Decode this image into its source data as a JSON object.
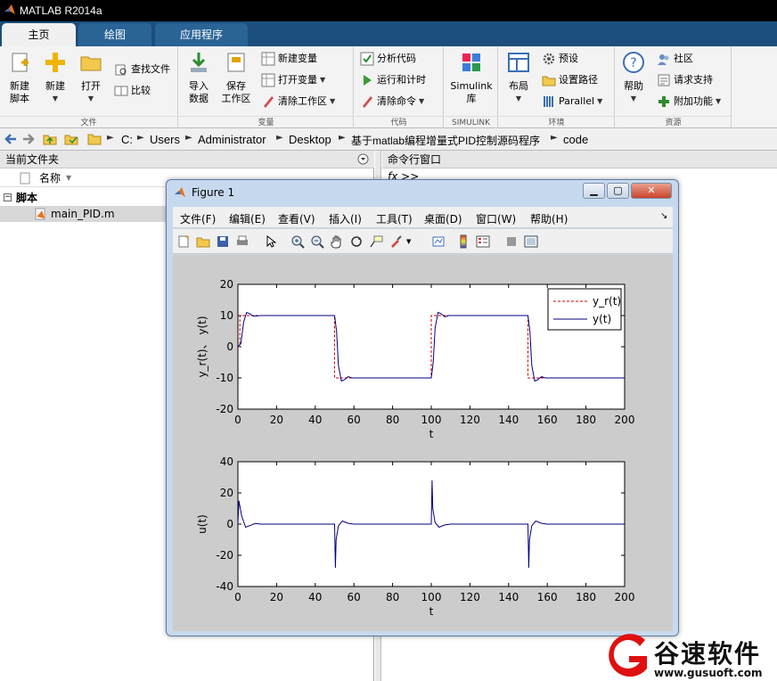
{
  "window": {
    "title": "MATLAB R2014a"
  },
  "ribbon_tabs": [
    {
      "label": "主页"
    },
    {
      "label": "绘图"
    },
    {
      "label": "应用程序"
    }
  ],
  "ribbon": {
    "file": {
      "label": "文件",
      "new_script": "新建\n脚本",
      "new": "新建",
      "open": "打开",
      "find_files": "查找文件",
      "compare": "比较"
    },
    "variable": {
      "label": "变量",
      "import": "导入\n数据",
      "save_ws": "保存\n工作区",
      "new_var": "新建变量",
      "open_var": "打开变量",
      "clear_ws": "清除工作区"
    },
    "code": {
      "label": "代码",
      "analyze": "分析代码",
      "run_time": "运行和计时",
      "clear_cmd": "清除命令"
    },
    "simulink": {
      "label": "SIMULINK",
      "lib": "Simulink\n库"
    },
    "env": {
      "label": "环境",
      "layout": "布局",
      "prefs": "预设",
      "set_path": "设置路径",
      "parallel": "Parallel"
    },
    "resources": {
      "label": "资源",
      "help": "帮助",
      "community": "社区",
      "support": "请求支持",
      "addons": "附加功能"
    }
  },
  "address": {
    "crumbs": [
      "C:",
      "Users",
      "Administrator",
      "Desktop",
      "基于matlab编程增量式PID控制源码程序",
      "code"
    ]
  },
  "current_folder": {
    "title": "当前文件夹",
    "col_name": "名称",
    "group": "脚本",
    "files": [
      "main_PID.m"
    ]
  },
  "command_window": {
    "title": "命令行窗口",
    "prompt": "fx >>"
  },
  "figure": {
    "title": "Figure 1",
    "menu": [
      "文件(F)",
      "编辑(E)",
      "查看(V)",
      "插入(I)",
      "工具(T)",
      "桌面(D)",
      "窗口(W)",
      "帮助(H)"
    ]
  },
  "chart_data": [
    {
      "type": "line",
      "xlabel": "t",
      "ylabel": "y_r(t)、 y(t)",
      "xlim": [
        0,
        200
      ],
      "ylim": [
        -20,
        20
      ],
      "xticks": [
        0,
        20,
        40,
        60,
        80,
        100,
        120,
        140,
        160,
        180,
        200
      ],
      "yticks": [
        -20,
        -10,
        0,
        10,
        20
      ],
      "legend_position": "top-right",
      "series": [
        {
          "name": "y_r(t)",
          "color": "#cc0000",
          "style": "dashed",
          "x": [
            0,
            1,
            1,
            50,
            50,
            100,
            100,
            150,
            150,
            200
          ],
          "y": [
            0,
            0,
            10,
            10,
            -10,
            -10,
            10,
            10,
            -10,
            -10
          ]
        },
        {
          "name": "y(t)",
          "color": "#000080",
          "style": "solid",
          "x": [
            0,
            1.5,
            3,
            4.5,
            6,
            8,
            12,
            50,
            51,
            52,
            53.5,
            55,
            57,
            59,
            62,
            100,
            101,
            102,
            103.5,
            105,
            107,
            109,
            112,
            150,
            151,
            152,
            153.5,
            155,
            157,
            159,
            162,
            200
          ],
          "y": [
            0,
            1,
            8,
            11,
            10.6,
            9.8,
            10,
            10,
            5,
            -6,
            -11,
            -10.6,
            -9.6,
            -10,
            -10,
            -10,
            -5,
            6,
            11,
            10.6,
            9.6,
            10,
            10,
            10,
            5,
            -6,
            -11,
            -10.6,
            -9.6,
            -10,
            -10,
            -10
          ]
        }
      ]
    },
    {
      "type": "line",
      "xlabel": "t",
      "ylabel": "u(t)",
      "xlim": [
        0,
        200
      ],
      "ylim": [
        -40,
        40
      ],
      "xticks": [
        0,
        20,
        40,
        60,
        80,
        100,
        120,
        140,
        160,
        180,
        200
      ],
      "yticks": [
        -40,
        -20,
        0,
        20,
        40
      ],
      "series": [
        {
          "color": "#000080",
          "style": "solid",
          "x": [
            0,
            0.5,
            2,
            4,
            6,
            9,
            12,
            50,
            50.4,
            50.8,
            52,
            54,
            57,
            60,
            100,
            100.4,
            100.8,
            102,
            104,
            107,
            110,
            150,
            150.4,
            150.8,
            152,
            154,
            157,
            160,
            200
          ],
          "y": [
            0,
            15,
            5,
            -2,
            -1,
            0.4,
            0,
            0,
            -28,
            -10,
            -1,
            2,
            0.5,
            0,
            0,
            28,
            10,
            1,
            -2,
            -0.5,
            0,
            0,
            -28,
            -10,
            -1,
            2,
            0.5,
            0,
            0
          ]
        }
      ]
    }
  ],
  "watermark": {
    "brand": "谷速软件",
    "url": "www.gusuoft.com"
  }
}
